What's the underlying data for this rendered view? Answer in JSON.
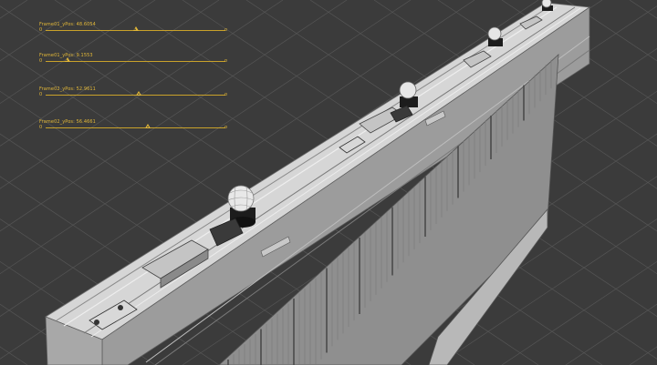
{
  "viewport": {
    "background": "#3b3b3b",
    "grid_color": "#555555",
    "accent": "#e3b838"
  },
  "sliders": [
    {
      "label": "Frame01_yPos: 48.6054",
      "min_label": "0",
      "value_fraction": 0.5
    },
    {
      "label": "Frame01_yPos: 9.1553",
      "min_label": "0",
      "value_fraction": 0.12
    },
    {
      "label": "Frame02_yPos: 52.9611",
      "min_label": "0",
      "value_fraction": 0.52
    },
    {
      "label": "Frame02_yPos: 56.4661",
      "min_label": "0",
      "value_fraction": 0.57
    }
  ]
}
